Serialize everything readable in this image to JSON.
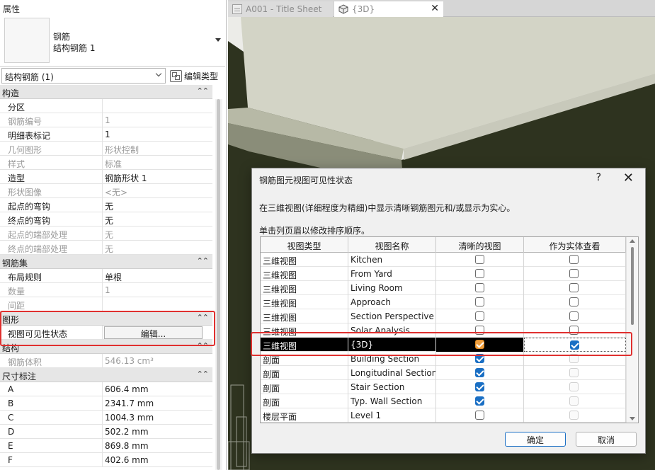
{
  "properties": {
    "title": "属性",
    "type_line1": "钢筋",
    "type_line2": "结构钢筋 1",
    "instance_select": "结构钢筋 (1)",
    "edit_type_label": "编辑类型",
    "rows": [
      {
        "kind": "cat",
        "label": "构造"
      },
      {
        "kind": "prop",
        "key": "分区",
        "value": ""
      },
      {
        "kind": "prop",
        "key": "钢筋编号",
        "value": "1",
        "dim": true
      },
      {
        "kind": "prop",
        "key": "明细表标记",
        "value": "1"
      },
      {
        "kind": "prop",
        "key": "几何图形",
        "value": "形状控制",
        "dim": true
      },
      {
        "kind": "prop",
        "key": "样式",
        "value": "标准",
        "dim": true
      },
      {
        "kind": "prop",
        "key": "造型",
        "value": "钢筋形状 1"
      },
      {
        "kind": "prop",
        "key": "形状图像",
        "value": "<无>",
        "dim": true
      },
      {
        "kind": "prop",
        "key": "起点的弯钩",
        "value": "无"
      },
      {
        "kind": "prop",
        "key": "终点的弯钩",
        "value": "无"
      },
      {
        "kind": "prop",
        "key": "起点的端部处理",
        "value": "无",
        "dim": true
      },
      {
        "kind": "prop",
        "key": "终点的端部处理",
        "value": "无",
        "dim": true
      },
      {
        "kind": "cat",
        "label": "钢筋集"
      },
      {
        "kind": "prop",
        "key": "布局规则",
        "value": "单根"
      },
      {
        "kind": "prop",
        "key": "数量",
        "value": "1",
        "dim": true
      },
      {
        "kind": "prop",
        "key": "间距",
        "value": "",
        "dim": true
      },
      {
        "kind": "cat",
        "label": "图形"
      },
      {
        "kind": "button",
        "key": "视图可见性状态",
        "value": "编辑..."
      },
      {
        "kind": "cat",
        "label": "结构"
      },
      {
        "kind": "prop",
        "key": "钢筋体积",
        "value": "546.13 cm³",
        "dim": true
      },
      {
        "kind": "cat",
        "label": "尺寸标注"
      },
      {
        "kind": "prop",
        "key": "A",
        "value": "606.4 mm"
      },
      {
        "kind": "prop",
        "key": "B",
        "value": "2341.7 mm"
      },
      {
        "kind": "prop",
        "key": "C",
        "value": "1004.3 mm"
      },
      {
        "kind": "prop",
        "key": "D",
        "value": "502.2 mm"
      },
      {
        "kind": "prop",
        "key": "E",
        "value": "869.8 mm"
      },
      {
        "kind": "prop",
        "key": "F",
        "value": "402.6 mm"
      }
    ]
  },
  "tabs": [
    {
      "label": "A001 - Title Sheet",
      "icon": "sheet-icon"
    },
    {
      "label": "{3D}",
      "icon": "cube-icon"
    }
  ],
  "dialog": {
    "title": "钢筋图元视图可见性状态",
    "help": "?",
    "close": "✕",
    "description": "在三维视图(详细程度为精细)中显示清晰钢筋图元和/或显示为实心。",
    "hint": "单击列页眉以修改排序顺序。",
    "headers": [
      "视图类型",
      "视图名称",
      "清晰的视图",
      "作为实体查看"
    ],
    "rows": [
      {
        "type": "三维视图",
        "name": "Kitchen",
        "clear": "off",
        "solid": "off"
      },
      {
        "type": "三维视图",
        "name": "From Yard",
        "clear": "off",
        "solid": "off"
      },
      {
        "type": "三维视图",
        "name": "Living Room",
        "clear": "off",
        "solid": "off"
      },
      {
        "type": "三维视图",
        "name": "Approach",
        "clear": "off",
        "solid": "off"
      },
      {
        "type": "三维视图",
        "name": "Section Perspective",
        "clear": "off",
        "solid": "off"
      },
      {
        "type": "三维视图",
        "name": "Solar Analysis",
        "clear": "off",
        "solid": "off"
      },
      {
        "type": "三维视图",
        "name": "{3D}",
        "clear": "orange",
        "solid": "on",
        "selected": true
      },
      {
        "type": "剖面",
        "name": "Building Section",
        "clear": "on",
        "solid": "disabled"
      },
      {
        "type": "剖面",
        "name": "Longitudinal Section",
        "clear": "on",
        "solid": "disabled"
      },
      {
        "type": "剖面",
        "name": "Stair Section",
        "clear": "on",
        "solid": "disabled"
      },
      {
        "type": "剖面",
        "name": "Typ. Wall Section",
        "clear": "on",
        "solid": "disabled"
      },
      {
        "type": "楼层平面",
        "name": "Level 1",
        "clear": "off",
        "solid": "disabled"
      }
    ],
    "ok_label": "确定",
    "cancel_label": "取消"
  },
  "colors": {
    "accent": "#1a6fc4",
    "highlight_box": "#e0302f",
    "viewport_bg": "#2e331f",
    "slab_top": "#d3d4c6"
  }
}
